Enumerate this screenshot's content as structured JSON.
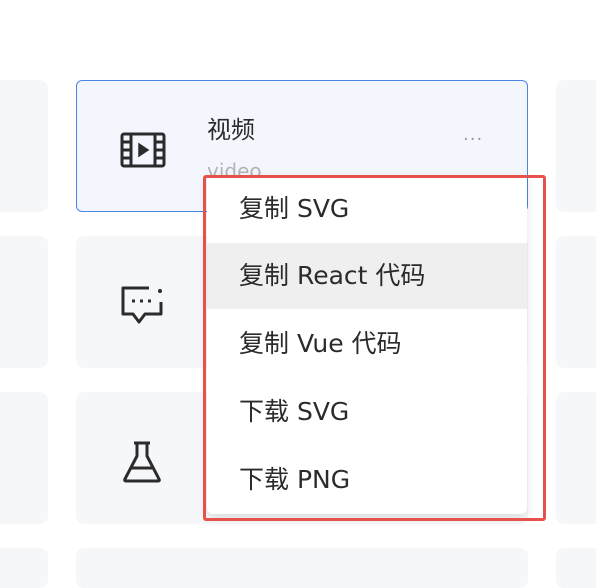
{
  "card": {
    "title": "视频",
    "subtitle": "video",
    "more_label": "···"
  },
  "context_menu": {
    "items": [
      {
        "label": "复制 SVG"
      },
      {
        "label": "复制 React 代码"
      },
      {
        "label": "复制 Vue 代码"
      },
      {
        "label": "下载 SVG"
      },
      {
        "label": "下载 PNG"
      }
    ]
  },
  "icons": {
    "selected_card": "film-play-icon",
    "row2": "chat-bubble-dots-icon",
    "row3": "flask-icon"
  },
  "colors": {
    "selected_border": "#4a86e8",
    "highlight_border": "#e5524a",
    "card_bg": "#f6f7f9",
    "menu_hover_bg": "#efefef"
  }
}
